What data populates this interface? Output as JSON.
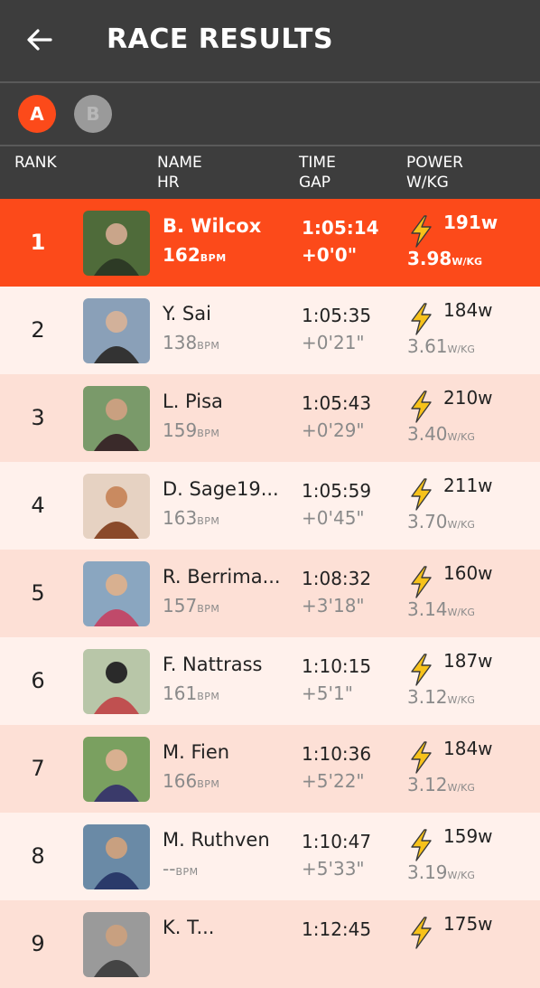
{
  "header": {
    "title": "RACE RESULTS",
    "back_icon": "arrow-left-icon"
  },
  "categories": [
    {
      "label": "A",
      "selected": true
    },
    {
      "label": "B",
      "selected": false
    }
  ],
  "columns": {
    "rank": "RANK",
    "name": "NAME",
    "hr": "HR",
    "time": "TIME",
    "gap": "GAP",
    "power": "POWER",
    "wkg": "W/KG"
  },
  "units": {
    "bpm": "BPM",
    "wkg": "W/KG"
  },
  "colors": {
    "accent": "#fc4a1a",
    "header": "#3d3d3d",
    "row_light": "#fff1ec",
    "row_alt": "#fde0d6",
    "bolt": "#f7c21a"
  },
  "results": [
    {
      "rank": "1",
      "name": "B. Wilcox",
      "hr": "162",
      "time": "1:05:14",
      "gap": "+0'0\"",
      "power": "191w",
      "wkg": "3.98",
      "highlight": true
    },
    {
      "rank": "2",
      "name": "Y. Sai",
      "hr": "138",
      "time": "1:05:35",
      "gap": "+0'21\"",
      "power": "184w",
      "wkg": "3.61"
    },
    {
      "rank": "3",
      "name": "L. Pisa",
      "hr": "159",
      "time": "1:05:43",
      "gap": "+0'29\"",
      "power": "210w",
      "wkg": "3.40"
    },
    {
      "rank": "4",
      "name": "D. Sage19...",
      "hr": "163",
      "time": "1:05:59",
      "gap": "+0'45\"",
      "power": "211w",
      "wkg": "3.70"
    },
    {
      "rank": "5",
      "name": "R. Berrima...",
      "hr": "157",
      "time": "1:08:32",
      "gap": "+3'18\"",
      "power": "160w",
      "wkg": "3.14"
    },
    {
      "rank": "6",
      "name": "F. Nattrass",
      "hr": "161",
      "time": "1:10:15",
      "gap": "+5'1\"",
      "power": "187w",
      "wkg": "3.12"
    },
    {
      "rank": "7",
      "name": "M. Fien",
      "hr": "166",
      "time": "1:10:36",
      "gap": "+5'22\"",
      "power": "184w",
      "wkg": "3.12"
    },
    {
      "rank": "8",
      "name": "M. Ruthven",
      "hr": "--",
      "time": "1:10:47",
      "gap": "+5'33\"",
      "power": "159w",
      "wkg": "3.19"
    },
    {
      "rank": "9",
      "name": "K. T...",
      "hr": "",
      "time": "1:12:45",
      "gap": "",
      "power": "175w",
      "wkg": ""
    }
  ]
}
